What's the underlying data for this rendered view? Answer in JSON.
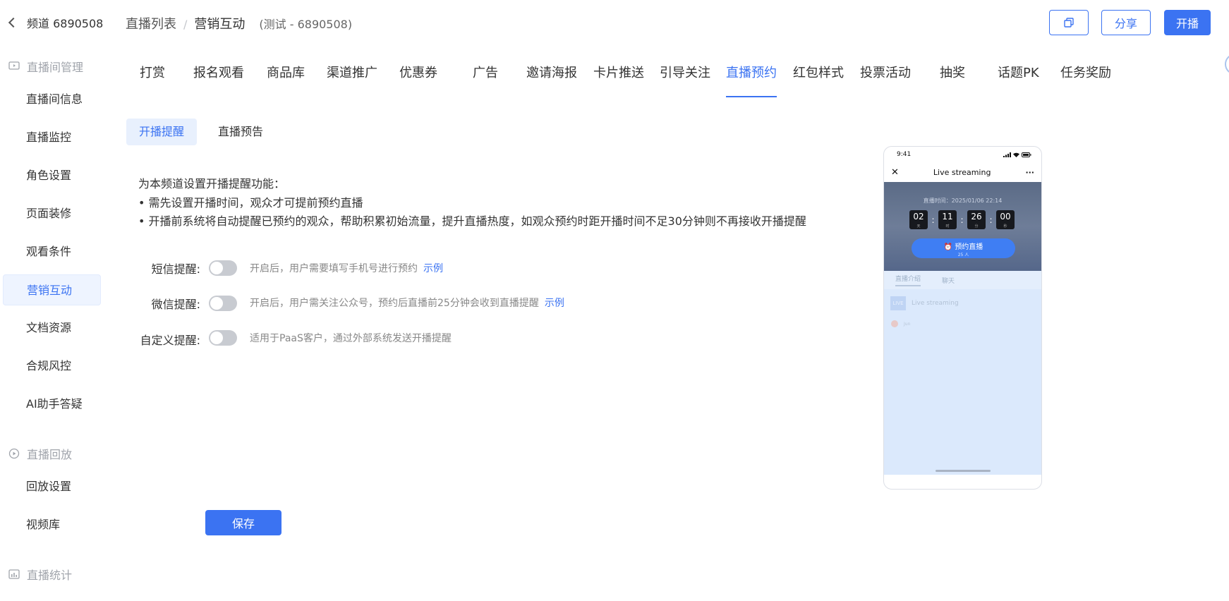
{
  "sidebar": {
    "channel": "频道 6890508",
    "groups": [
      {
        "title": "直播间管理",
        "icon": "tv-icon"
      },
      {
        "title": "直播回放",
        "icon": "replay-icon"
      },
      {
        "title": "直播统计",
        "icon": "stats-icon"
      }
    ],
    "items": [
      {
        "label": "直播间信息"
      },
      {
        "label": "直播监控"
      },
      {
        "label": "角色设置"
      },
      {
        "label": "页面装修"
      },
      {
        "label": "观看条件"
      },
      {
        "label": "营销互动",
        "active": true
      },
      {
        "label": "文档资源"
      },
      {
        "label": "合规风控"
      },
      {
        "label": "AI助手答疑"
      },
      {
        "label": "回放设置"
      },
      {
        "label": "视频库"
      }
    ]
  },
  "header": {
    "breadcrumb_root": "直播列表",
    "breadcrumb_sep": "/",
    "breadcrumb_current": "营销互动",
    "breadcrumb_sub": "(测试 - 6890508)",
    "share_label": "分享",
    "start_label": "开播",
    "copy_icon": "copy-icon"
  },
  "tabs": [
    {
      "label": "打赏"
    },
    {
      "label": "报名观看"
    },
    {
      "label": "商品库"
    },
    {
      "label": "渠道推广"
    },
    {
      "label": "优惠券"
    },
    {
      "label": "广告"
    },
    {
      "label": "邀请海报"
    },
    {
      "label": "卡片推送"
    },
    {
      "label": "引导关注"
    },
    {
      "label": "直播预约",
      "active": true
    },
    {
      "label": "红包样式"
    },
    {
      "label": "投票活动"
    },
    {
      "label": "抽奖"
    },
    {
      "label": "话题PK"
    },
    {
      "label": "任务奖励"
    }
  ],
  "subtabs": [
    {
      "label": "开播提醒",
      "active": true
    },
    {
      "label": "直播预告"
    }
  ],
  "description": {
    "intro": "为本频道设置开播提醒功能：",
    "line1": "• 需先设置开播时间，观众才可提前预约直播",
    "line2": "• 开播前系统将自动提醒已预约的观众，帮助积累初始流量，提升直播热度，如观众预约时距开播时间不足30分钟则不再接收开播提醒"
  },
  "reminders": {
    "sms": {
      "label": "短信提醒:",
      "hint": "开启后，用户需要填写手机号进行预约",
      "link": "示例",
      "enabled": false
    },
    "wechat": {
      "label": "微信提醒:",
      "hint": "开启后，用户需关注公众号，预约后直播前25分钟会收到直播提醒",
      "link": "示例",
      "enabled": false
    },
    "custom": {
      "label": "自定义提醒:",
      "hint": "适用于PaaS客户，通过外部系统发送开播提醒",
      "enabled": false
    }
  },
  "save_label": "保存",
  "preview": {
    "status_time": "9:41",
    "title": "Live streaming",
    "more": "···",
    "close": "✕",
    "time_label": "直播时间：2025/01/06 22:14",
    "countdown": [
      {
        "value": "02",
        "unit": "天"
      },
      {
        "value": "11",
        "unit": "时"
      },
      {
        "value": "26",
        "unit": "分"
      },
      {
        "value": "00",
        "unit": "秒"
      }
    ],
    "remind_label": "预约直播",
    "remind_count": "25 人",
    "tab_intro": "直播介绍",
    "tab_chat": "聊天",
    "live_tag": "LIVE",
    "live_title": "Live streaming",
    "msg_name": "Jun"
  },
  "colors": {
    "accent": "#3b73f2",
    "active_bg": "#eef4ff",
    "toggle_off": "#c8cbd1"
  }
}
